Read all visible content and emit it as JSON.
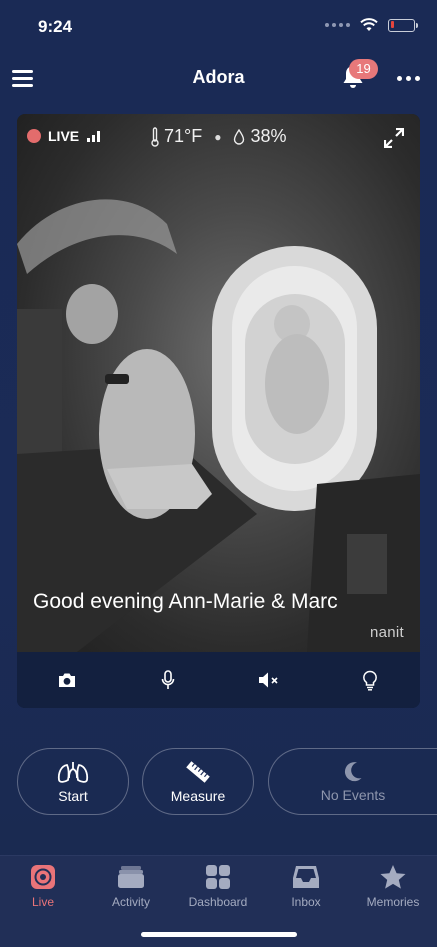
{
  "status_bar": {
    "time": "9:24",
    "battery_level": 0.15,
    "battery_color": "#e5453d"
  },
  "header": {
    "title": "Adora",
    "notification_count": "19"
  },
  "video": {
    "live_label": "LIVE",
    "temperature": "71°F",
    "humidity": "38%",
    "greeting": "Good evening Ann-Marie & Marc",
    "brand": "nanit"
  },
  "controls": {
    "items": [
      {
        "icon": "camera-icon"
      },
      {
        "icon": "microphone-icon"
      },
      {
        "icon": "speaker-muted-icon"
      },
      {
        "icon": "light-bulb-icon"
      }
    ]
  },
  "actions": {
    "start_label": "Start",
    "measure_label": "Measure",
    "no_events_label": "No Events"
  },
  "tabs": [
    {
      "label": "Live",
      "icon": "live-target-icon",
      "active": true
    },
    {
      "label": "Activity",
      "icon": "activity-cards-icon"
    },
    {
      "label": "Dashboard",
      "icon": "dashboard-grid-icon"
    },
    {
      "label": "Inbox",
      "icon": "inbox-tray-icon"
    },
    {
      "label": "Memories",
      "icon": "star-icon"
    }
  ],
  "colors": {
    "accent": "#e97479",
    "background": "#1a2a55",
    "live_dot": "#e36c6c"
  }
}
